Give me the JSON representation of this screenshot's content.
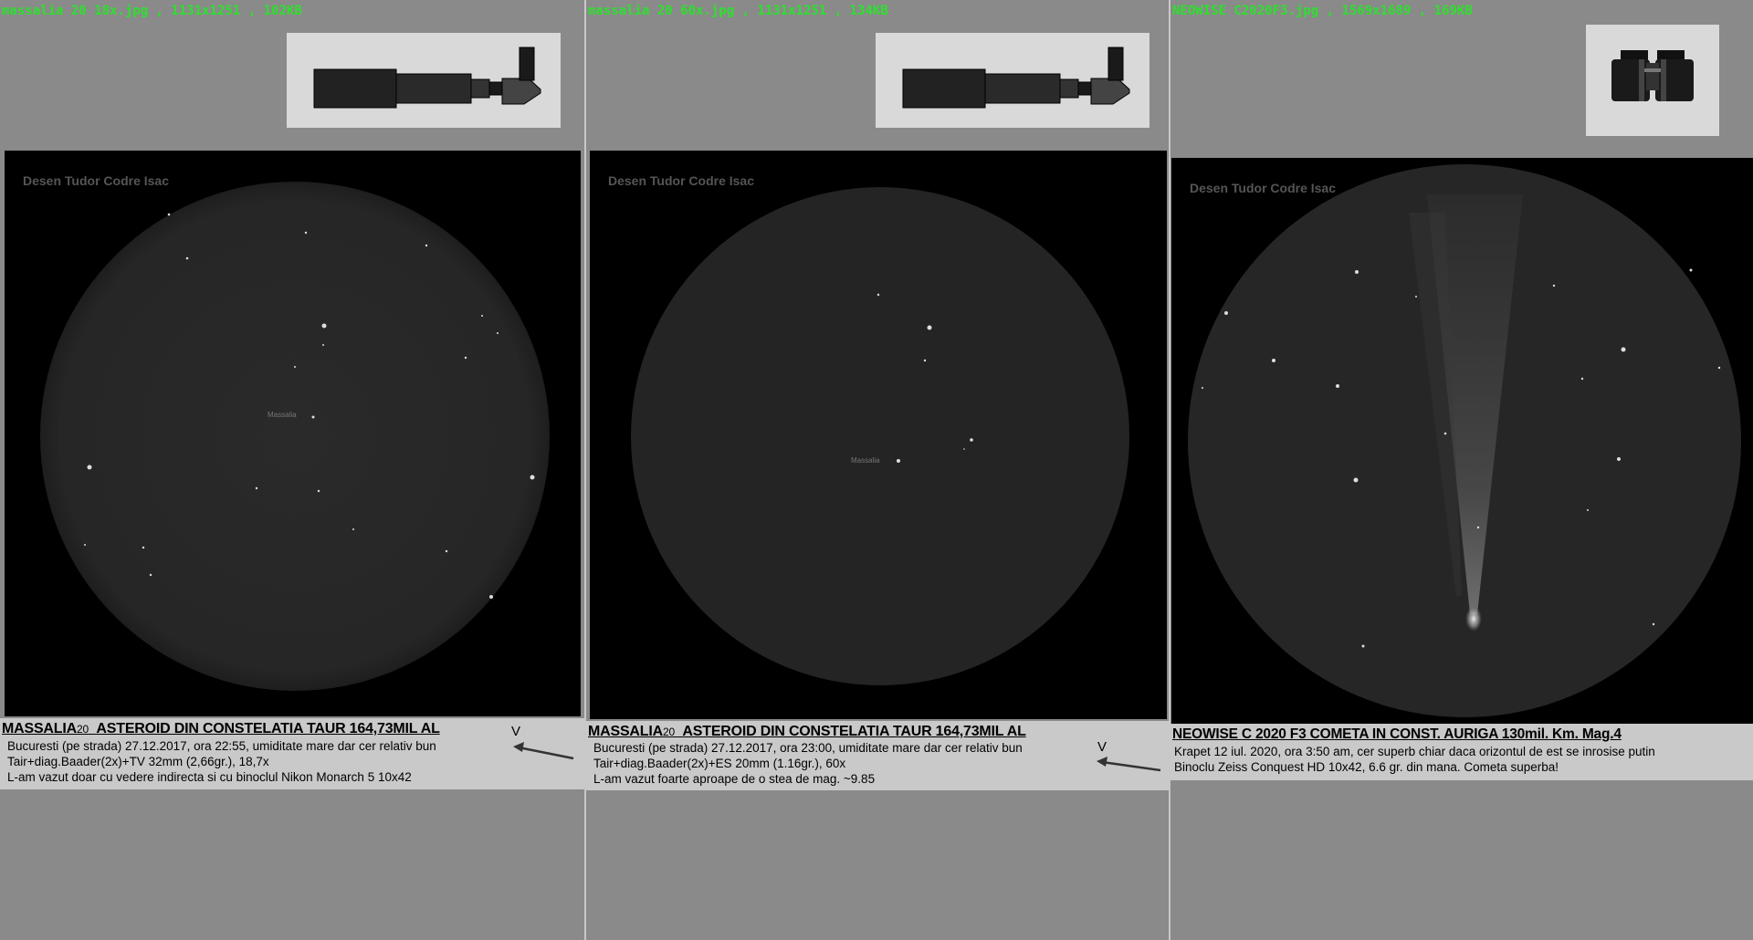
{
  "panels": [
    {
      "file": {
        "name": "massalia 20 18x.jpg",
        "dims": "1131x1251",
        "size": "102KB"
      },
      "instrument": "telescope-icon",
      "watermark": "Desen Tudor Codre Isac",
      "object_label": "Massalia",
      "title_main": "MASSALIA",
      "title_sub": "20",
      "title_rest": "ASTEROID DIN CONSTELATIA TAUR 164,73MIL AL",
      "line1": "Bucuresti (pe strada) 27.12.2017, ora 22:55, umiditate mare dar cer relativ bun",
      "line2": "Tair+diag.Baader(2x)+TV 32mm (2,66gr.), 18,7x",
      "line3": "L-am vazut doar cu vedere indirecta si cu binoclul Nikon Monarch 5 10x42",
      "v_mark": "V"
    },
    {
      "file": {
        "name": "massalia 20 60x.jpg",
        "dims": "1131x1251",
        "size": "134KB"
      },
      "instrument": "telescope-icon",
      "watermark": "Desen Tudor Codre Isac",
      "object_label": "Massalia",
      "title_main": "MASSALIA",
      "title_sub": "20",
      "title_rest": "ASTEROID DIN CONSTELATIA TAUR 164,73MIL AL",
      "line1": "Bucuresti (pe strada) 27.12.2017, ora 23:00, umiditate mare dar cer relativ bun",
      "line2": "Tair+diag.Baader(2x)+ES 20mm (1.16gr.), 60x",
      "line3": "L-am vazut foarte aproape de o stea de mag. ~9.85",
      "v_mark": "V"
    },
    {
      "file": {
        "name": "NEOWISE C2020F3.jpg",
        "dims": "1569x1689",
        "size": "169KB"
      },
      "instrument": "binoculars-icon",
      "watermark": "Desen Tudor Codre Isac",
      "title_main": "NEOWISE C 2020 F3 COMETA IN CONST. AURIGA 130mil. Km. Mag.4",
      "line1": "Krapet 12 iul. 2020, ora 3:50 am, cer superb chiar daca orizontul de est se inrosise putin",
      "line2": "Binoclu Zeiss Conquest HD 10x42, 6.6 gr. din mana. Cometa superba!"
    }
  ],
  "separator": " , "
}
